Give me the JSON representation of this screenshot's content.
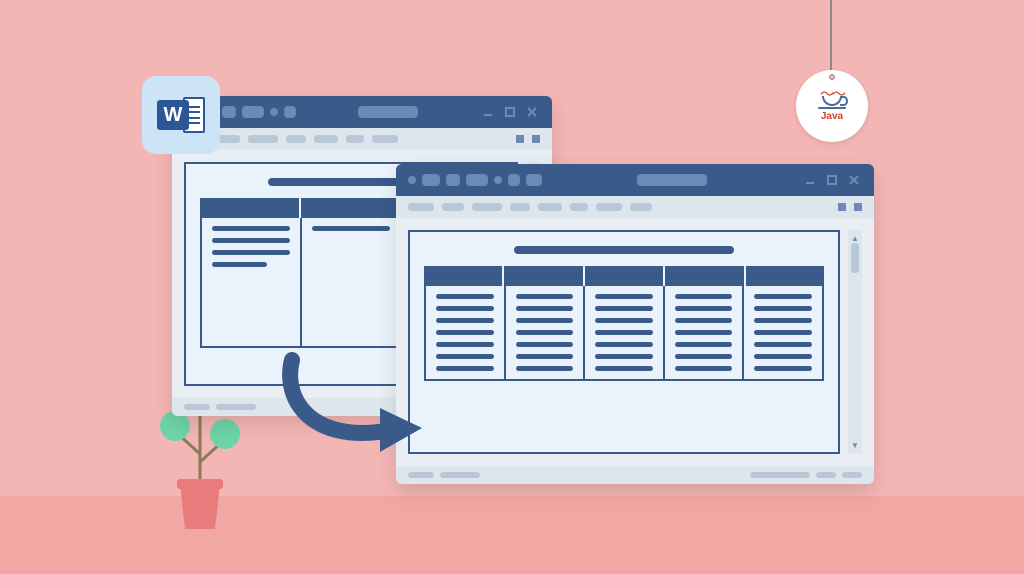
{
  "illustration": {
    "badge": {
      "app": "Microsoft Word",
      "letter": "W"
    },
    "tag": {
      "label": "Java"
    },
    "source_window": {
      "columns": 3,
      "rows_per_column": [
        4,
        1,
        1
      ]
    },
    "target_window": {
      "columns": 5,
      "rows_per_column": 7
    },
    "window_controls": [
      "minimize",
      "maximize",
      "close"
    ],
    "colors": {
      "background": "#f4b5b5",
      "floor": "#f1a8a4",
      "window_chrome": "#3a5a8a",
      "page": "#eaf2fb",
      "plant_leaf": "#6ed4a8",
      "pot": "#e87b7b"
    }
  }
}
